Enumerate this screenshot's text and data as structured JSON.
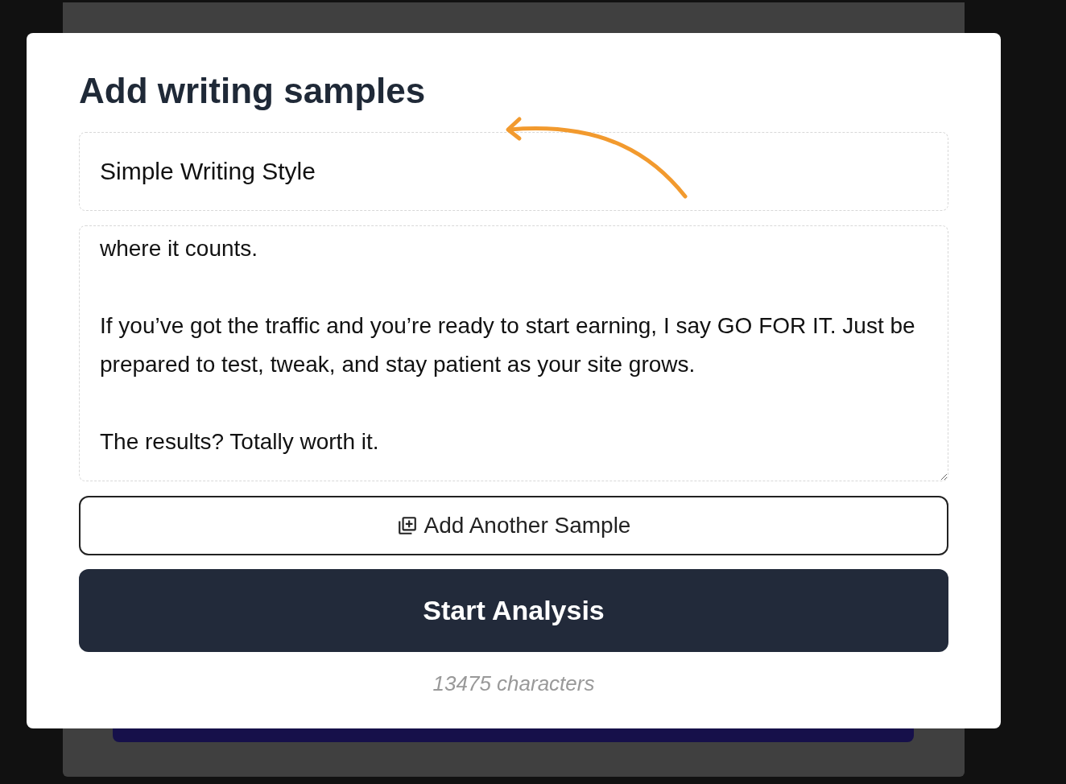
{
  "dialog": {
    "title": "Add writing samples",
    "name_field": {
      "value": "Simple Writing Style"
    },
    "sample_field": {
      "value": "where it counts.\n\nIf you’ve got the traffic and you’re ready to start earning, I say GO FOR IT. Just be prepared to test, tweak, and stay patient as your site grows.\n\nThe results? Totally worth it."
    },
    "add_button": "Add Another Sample",
    "submit_button": "Start Analysis",
    "character_count": "13475 characters"
  }
}
